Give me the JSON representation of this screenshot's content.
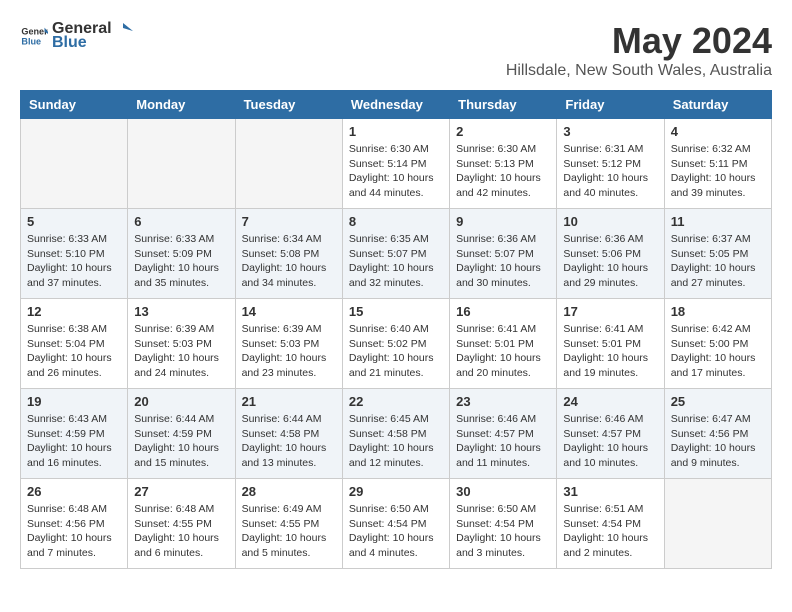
{
  "header": {
    "logo_general": "General",
    "logo_blue": "Blue",
    "title": "May 2024",
    "subtitle": "Hillsdale, New South Wales, Australia"
  },
  "days_of_week": [
    "Sunday",
    "Monday",
    "Tuesday",
    "Wednesday",
    "Thursday",
    "Friday",
    "Saturday"
  ],
  "weeks": [
    [
      {
        "day": "",
        "empty": true
      },
      {
        "day": "",
        "empty": true
      },
      {
        "day": "",
        "empty": true
      },
      {
        "day": "1",
        "sunrise": "6:30 AM",
        "sunset": "5:14 PM",
        "daylight": "10 hours and 44 minutes."
      },
      {
        "day": "2",
        "sunrise": "6:30 AM",
        "sunset": "5:13 PM",
        "daylight": "10 hours and 42 minutes."
      },
      {
        "day": "3",
        "sunrise": "6:31 AM",
        "sunset": "5:12 PM",
        "daylight": "10 hours and 40 minutes."
      },
      {
        "day": "4",
        "sunrise": "6:32 AM",
        "sunset": "5:11 PM",
        "daylight": "10 hours and 39 minutes."
      }
    ],
    [
      {
        "day": "5",
        "sunrise": "6:33 AM",
        "sunset": "5:10 PM",
        "daylight": "10 hours and 37 minutes."
      },
      {
        "day": "6",
        "sunrise": "6:33 AM",
        "sunset": "5:09 PM",
        "daylight": "10 hours and 35 minutes."
      },
      {
        "day": "7",
        "sunrise": "6:34 AM",
        "sunset": "5:08 PM",
        "daylight": "10 hours and 34 minutes."
      },
      {
        "day": "8",
        "sunrise": "6:35 AM",
        "sunset": "5:07 PM",
        "daylight": "10 hours and 32 minutes."
      },
      {
        "day": "9",
        "sunrise": "6:36 AM",
        "sunset": "5:07 PM",
        "daylight": "10 hours and 30 minutes."
      },
      {
        "day": "10",
        "sunrise": "6:36 AM",
        "sunset": "5:06 PM",
        "daylight": "10 hours and 29 minutes."
      },
      {
        "day": "11",
        "sunrise": "6:37 AM",
        "sunset": "5:05 PM",
        "daylight": "10 hours and 27 minutes."
      }
    ],
    [
      {
        "day": "12",
        "sunrise": "6:38 AM",
        "sunset": "5:04 PM",
        "daylight": "10 hours and 26 minutes."
      },
      {
        "day": "13",
        "sunrise": "6:39 AM",
        "sunset": "5:03 PM",
        "daylight": "10 hours and 24 minutes."
      },
      {
        "day": "14",
        "sunrise": "6:39 AM",
        "sunset": "5:03 PM",
        "daylight": "10 hours and 23 minutes."
      },
      {
        "day": "15",
        "sunrise": "6:40 AM",
        "sunset": "5:02 PM",
        "daylight": "10 hours and 21 minutes."
      },
      {
        "day": "16",
        "sunrise": "6:41 AM",
        "sunset": "5:01 PM",
        "daylight": "10 hours and 20 minutes."
      },
      {
        "day": "17",
        "sunrise": "6:41 AM",
        "sunset": "5:01 PM",
        "daylight": "10 hours and 19 minutes."
      },
      {
        "day": "18",
        "sunrise": "6:42 AM",
        "sunset": "5:00 PM",
        "daylight": "10 hours and 17 minutes."
      }
    ],
    [
      {
        "day": "19",
        "sunrise": "6:43 AM",
        "sunset": "4:59 PM",
        "daylight": "10 hours and 16 minutes."
      },
      {
        "day": "20",
        "sunrise": "6:44 AM",
        "sunset": "4:59 PM",
        "daylight": "10 hours and 15 minutes."
      },
      {
        "day": "21",
        "sunrise": "6:44 AM",
        "sunset": "4:58 PM",
        "daylight": "10 hours and 13 minutes."
      },
      {
        "day": "22",
        "sunrise": "6:45 AM",
        "sunset": "4:58 PM",
        "daylight": "10 hours and 12 minutes."
      },
      {
        "day": "23",
        "sunrise": "6:46 AM",
        "sunset": "4:57 PM",
        "daylight": "10 hours and 11 minutes."
      },
      {
        "day": "24",
        "sunrise": "6:46 AM",
        "sunset": "4:57 PM",
        "daylight": "10 hours and 10 minutes."
      },
      {
        "day": "25",
        "sunrise": "6:47 AM",
        "sunset": "4:56 PM",
        "daylight": "10 hours and 9 minutes."
      }
    ],
    [
      {
        "day": "26",
        "sunrise": "6:48 AM",
        "sunset": "4:56 PM",
        "daylight": "10 hours and 7 minutes."
      },
      {
        "day": "27",
        "sunrise": "6:48 AM",
        "sunset": "4:55 PM",
        "daylight": "10 hours and 6 minutes."
      },
      {
        "day": "28",
        "sunrise": "6:49 AM",
        "sunset": "4:55 PM",
        "daylight": "10 hours and 5 minutes."
      },
      {
        "day": "29",
        "sunrise": "6:50 AM",
        "sunset": "4:54 PM",
        "daylight": "10 hours and 4 minutes."
      },
      {
        "day": "30",
        "sunrise": "6:50 AM",
        "sunset": "4:54 PM",
        "daylight": "10 hours and 3 minutes."
      },
      {
        "day": "31",
        "sunrise": "6:51 AM",
        "sunset": "4:54 PM",
        "daylight": "10 hours and 2 minutes."
      },
      {
        "day": "",
        "empty": true
      }
    ]
  ]
}
